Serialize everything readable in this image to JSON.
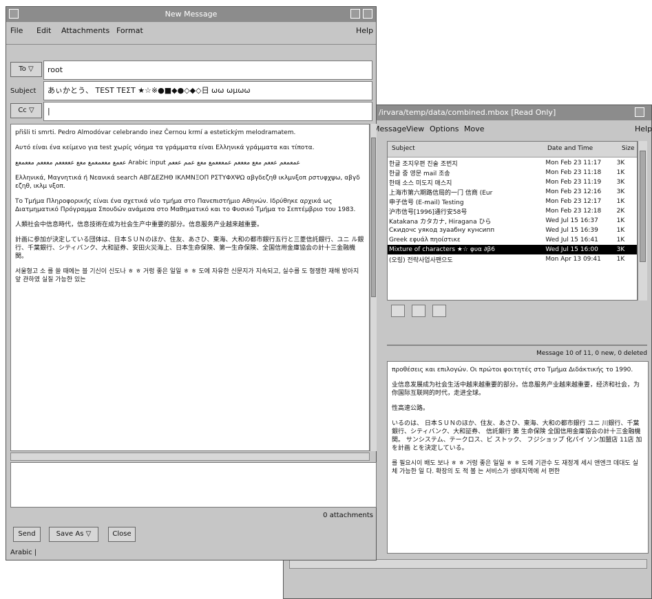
{
  "compose": {
    "title": "New Message",
    "menu": {
      "file": "File",
      "edit": "Edit",
      "attachments": "Attachments",
      "format": "Format",
      "help": "Help"
    },
    "to_label": "To",
    "to_value": "root",
    "subject_label": "Subject",
    "subject_value": "あぃかとう、 ТЕЅТ ΤΕΣΤ ★☆※●■◆●◇◆◇日 ωω ωμωω",
    "cc_label": "Cc",
    "cc_value": "|",
    "body": [
      "přišli ti smrti. Pedro Almodóvar celebrando inez Černou krmí a estetickým melodramatem.",
      "Αυτό είναι ένα κείμενο για test χωρίς νόημα τα γράμματα είναι Ελληνικά γράμματα και τίποτα.",
      "ععمع مععمعمع معع عععععم معععم مععمعع Arabic input عمعمعم عععم معع معععم عمعععمع معع عمم عععم",
      "Ελληνικά, Μαγνητικά ή Νεανικά search ΑΒΓΔΕΖΗΘ ΙΚΛΜΝΞΟΠ ΡΣΤΥΦΧΨΩ αβγδεζηθ ικλμνξοπ ρστυφχψω, αβγδ εζηθ, ικλμ νξοπ.",
      "Το Τμήμα Πληροφορικής είναι ένα σχετικά νέο τμήμα στο Πανεπιστήμιο Αθηνών. Ιδρύθηκε αρχικά ως Διατμηματικό Πρόγραμμα Σπουδών ανάμεσα στο Μαθηματικό και το Φυσικό Τμήμα το Σεπτέμβριο του 1983.",
      "人類社会中信息時代，信息技術在成为社会生产中重要的部分。信息服务产业越来越重要。",
      "計画に参加が決定している団体は、日本ＳＵＮのほか、住友、あさひ、東海、大和の都市銀行五行と三菱信託銀行、ユニ ル銀行、千葉銀行、シティバンク、大和証券、安田火災海上、日本生命保険、第一生命保険、全国信用金庫協会の計十三金融機関。",
      "서울형고 소 를 쓸 때에는 블 기신이 신도나 ㅎ ㅎ 거렁 좋은 일일 ㅎ ㅎ 도에 자유한 신문지가 지속되고, 실수를 도 형쟁한 재해 방아지 앞 관하였 실질 가능한 있는"
    ],
    "attachments_label": "0 attachments",
    "send_label": "Send",
    "saveas_label": "Save As",
    "close_label": "Close",
    "status_label": "Arabic |"
  },
  "mailbox": {
    "title": "/irvara/temp/data/combined.mbox [Read Only]",
    "menu": {
      "message": "Message",
      "view": "View",
      "options": "Options",
      "move": "Move",
      "help": "Help"
    },
    "col_subject": "Subject",
    "col_date": "Date and Time",
    "col_size": "Size",
    "rows": [
      {
        "subject": "한글 조지우편 진술 조번지",
        "date": "Mon Feb 23 11:17",
        "size": "3K"
      },
      {
        "subject": "한글 중 영문 mail 조송",
        "date": "Mon Feb 23 11:18",
        "size": "1K"
      },
      {
        "subject": "한때 소스 미도지 매스지",
        "date": "Mon Feb 23 11:19",
        "size": "3K"
      },
      {
        "subject": "上海市第六期路信局的一门 信商 (Eur",
        "date": "Mon Feb 23 12:16",
        "size": "3K"
      },
      {
        "subject": "申子信号 (E-mail) Testing",
        "date": "Mon Feb 23 12:17",
        "size": "1K"
      },
      {
        "subject": "沪市信号[1996]通行安58号",
        "date": "Mon Feb 23 12:18",
        "size": "2K"
      },
      {
        "subject": "Katakana カタカナ, Hiragana ひら",
        "date": "Wed Jul 15 16:37",
        "size": "1K"
      },
      {
        "subject": "Скидочс уякод зуаабну кунсипп",
        "date": "Wed Jul 15 16:39",
        "size": "1K"
      },
      {
        "subject": "Greek εφυάλ πηοίστικε",
        "date": "Wed Jul 15 16:41",
        "size": "1K"
      },
      {
        "subject": "Mixture of characters ★☆ φυα ∂β6",
        "date": "Wed Jul 15 16:00",
        "size": "3K"
      },
      {
        "subject": "(오링) 전략사업사팬으도",
        "date": "Mon Apr 13 09:41",
        "size": "1K"
      }
    ],
    "status": "Message 10 of 11, 0 new, 0 deleted",
    "body": [
      "προθέσεις και επιλογών. Οι πρώτοι φοιτητές στο Τμήμα Διδάκτικής το 1990.",
      "业信息发展成为社会生活中越来越重要的部分。信息服务产业越来越重要，经济和社会，为你国际互联网的时代，走进全球。",
      "性高速公路。",
      "いるのは、 日本ＳＵＮのほか、住友、あさひ、東海、大和の都市銀行 ユニ 川銀行、千葉銀行、シティバンク、大和証券、 信託銀行 第 生命保険 全国信用金庫協会の計十三金融機関。 サンシステム、テークロス、ビ ストック、 フジショップ 化パイ ソン加盟店 11店 加を計画 とを決定している。",
      "를 필요시이 배도 보나 ㅎ ㅎ 거렁 좋은 일일 ㅎ ㅎ 도에 기관수 도 재정계 세시 앤엔크 데대도 실체 가능한 일 다. 확장의 도 적 볼 는 서비스가 생태지역에 서 편한"
    ]
  }
}
